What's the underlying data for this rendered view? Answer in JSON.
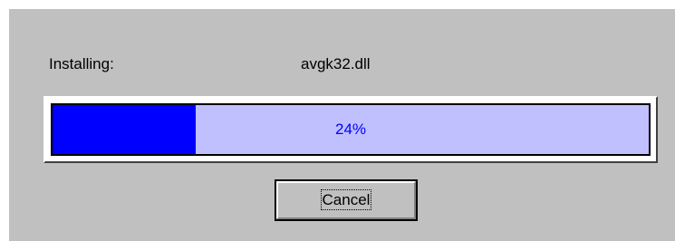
{
  "dialog": {
    "status_label": "Installing:",
    "file_name": "avgk32.dll",
    "progress": {
      "percent": 24,
      "text": "24%",
      "fill_color": "#0000ff",
      "track_color": "#c0c0ff"
    },
    "cancel_label": "Cancel"
  }
}
